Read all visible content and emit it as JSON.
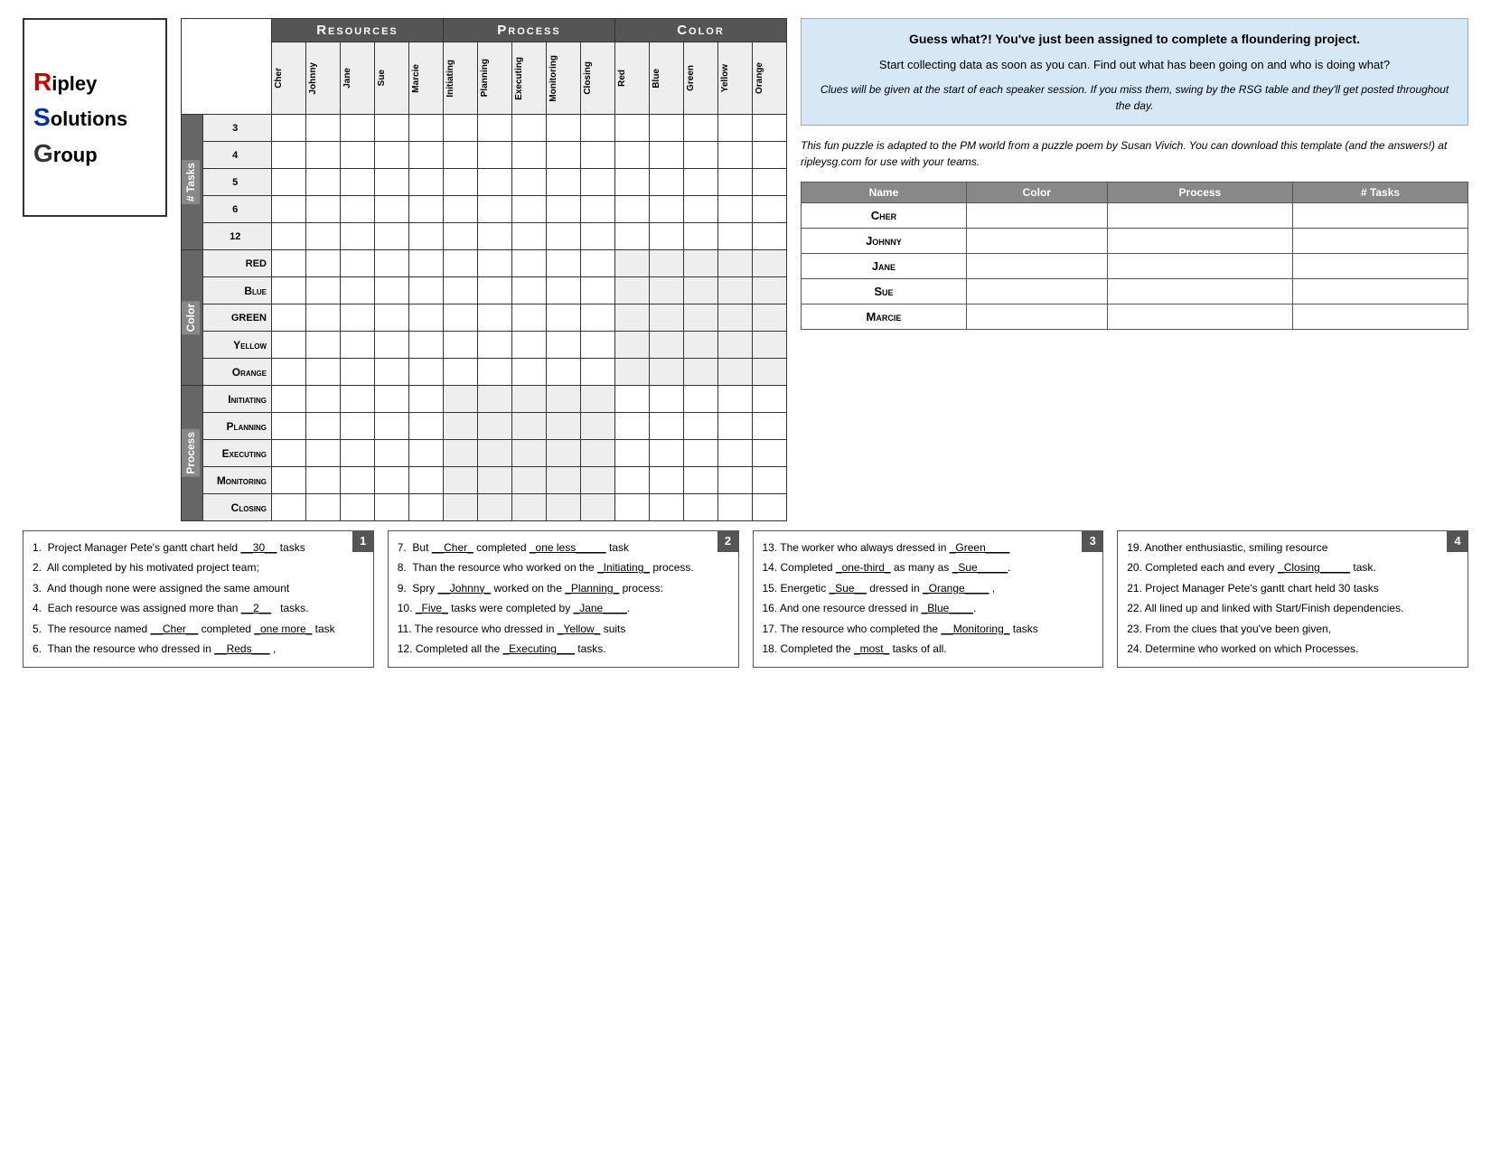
{
  "logo": {
    "line1": "ipley",
    "line2": "olutions",
    "line3": "roup",
    "r": "R",
    "s": "S",
    "g": "G"
  },
  "header": {
    "resources": "Resources",
    "process": "Process",
    "color": "Color"
  },
  "columns": {
    "resources": [
      "Cher",
      "Johnny",
      "Jane",
      "Sue",
      "Marcie"
    ],
    "process": [
      "Initiating",
      "Planning",
      "Executing",
      "Monitoring",
      "Closing"
    ],
    "color": [
      "Red",
      "Blue",
      "Green",
      "Yellow",
      "Orange"
    ]
  },
  "rows": {
    "tasks_label": "# Tasks",
    "tasks": [
      "3",
      "4",
      "5",
      "6",
      "12"
    ],
    "color_label": "Color",
    "colors": [
      "Red",
      "Blue",
      "Green",
      "Yellow",
      "Orange"
    ],
    "process_label": "Process",
    "processes": [
      "Initiating",
      "Planning",
      "Executing",
      "Monitoring",
      "Closing"
    ]
  },
  "info_box": {
    "title": "Guess what?! You've just been assigned to complete a floundering project.",
    "body1": "Start collecting data as soon as you can.  Find out what has been going on and who is doing what?",
    "body2": "Clues will be given at the start of each speaker session.  If you miss them, swing by the RSG table and they'll get posted throughout the day.",
    "italic": "This fun puzzle is adapted to the PM world from a puzzle poem by Susan Vivich.  You can download this template (and the answers!) at ripleysg.com for use with your teams."
  },
  "answer_table": {
    "headers": [
      "Name",
      "Color",
      "Process",
      "# Tasks"
    ],
    "rows": [
      {
        "name": "Cher"
      },
      {
        "name": "Johnny"
      },
      {
        "name": "Jane"
      },
      {
        "name": "Sue"
      },
      {
        "name": "Marcie"
      }
    ]
  },
  "clues": {
    "box1": {
      "badge": "1",
      "items": [
        "1.  Project Manager Pete’s gantt chart held __30__ tasks",
        "2.  All completed by his motivated project team;",
        "3.  And though none were assigned the same amount",
        "4.  Each resource was assigned more than __2____ tasks.",
        "5.  The resource named __Cher__ completed _one more_ task",
        "6.  Than the resource who dressed in __Reds___ ,"
      ]
    },
    "box2": {
      "badge": "2",
      "items": [
        "7.  But __Cher_ completed _one less_____ task",
        "8.  Than the resource who worked on the _Initiating_ process.",
        "9.  Spry __Johnny_ worked on the _Planning_ process:",
        "10. _Five_ tasks were completed by _Jane____.",
        "11. The resource who dressed in _Yellow_ suits",
        "12. Completed all the _Executing___ tasks."
      ]
    },
    "box3": {
      "badge": "3",
      "items": [
        "13. The worker who always dressed in _Green____",
        "14. Completed _one-third_ as many as _Sue_____.",
        "15. Energetic _Sue__ dressed in _Orange____ ,",
        "16. And one resource dressed in _Blue____.",
        "17. The resource who completed the __Monitoring_ tasks",
        "18. Completed the _most_ tasks of all."
      ]
    },
    "box4": {
      "badge": "4",
      "items": [
        "19. Another enthusiastic, smiling resource",
        "20. Completed each and every _Closing_____ task.",
        "21. Project Manager Pete’s gantt chart held 30 tasks",
        "22. All lined up and linked with Start/Finish dependencies.",
        "23. From the clues that you’ve been given,",
        "24. Determine who worked on which Processes."
      ]
    }
  }
}
